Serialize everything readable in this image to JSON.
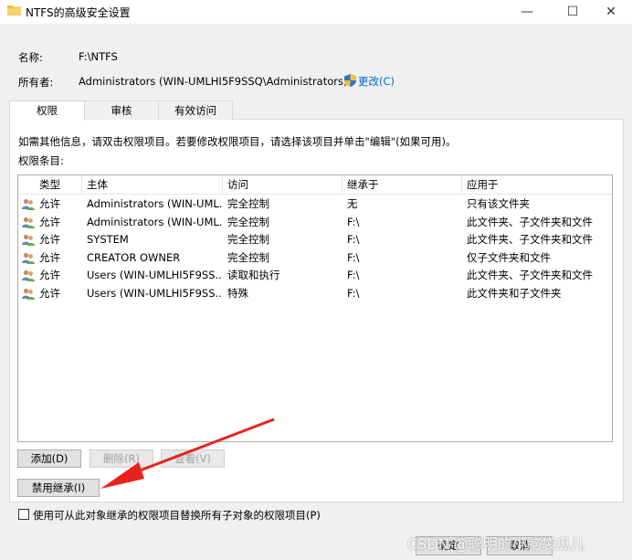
{
  "window": {
    "title": "NTFS的高级安全设置",
    "minimize": "—",
    "maximize": "☐",
    "close": "✕"
  },
  "info": {
    "name_label": "名称:",
    "name_value": "F:\\NTFS",
    "owner_label": "所有者:",
    "owner_value": "Administrators (WIN-UMLHI5F9SSQ\\Administrators)",
    "change_link": "更改(C)"
  },
  "tabs": [
    {
      "label": "权限"
    },
    {
      "label": "审核"
    },
    {
      "label": "有效访问"
    }
  ],
  "panel": {
    "description": "如需其他信息，请双击权限项目。若要修改权限项目，请选择该项目并单击\"编辑\"(如果可用)。",
    "entries_label": "权限条目:"
  },
  "table": {
    "columns": [
      "类型",
      "主体",
      "访问",
      "继承于",
      "应用于"
    ],
    "rows": [
      {
        "type": "允许",
        "principal": "Administrators (WIN-UML...",
        "access": "完全控制",
        "inherited": "无",
        "applies": "只有该文件夹"
      },
      {
        "type": "允许",
        "principal": "Administrators (WIN-UML...",
        "access": "完全控制",
        "inherited": "F:\\",
        "applies": "此文件夹、子文件夹和文件"
      },
      {
        "type": "允许",
        "principal": "SYSTEM",
        "access": "完全控制",
        "inherited": "F:\\",
        "applies": "此文件夹、子文件夹和文件"
      },
      {
        "type": "允许",
        "principal": "CREATOR OWNER",
        "access": "完全控制",
        "inherited": "F:\\",
        "applies": "仅子文件夹和文件"
      },
      {
        "type": "允许",
        "principal": "Users (WIN-UMLHI5F9SS...",
        "access": "读取和执行",
        "inherited": "F:\\",
        "applies": "此文件夹、子文件夹和文件"
      },
      {
        "type": "允许",
        "principal": "Users (WIN-UMLHI5F9SS...",
        "access": "特殊",
        "inherited": "F:\\",
        "applies": "此文件夹和子文件夹"
      }
    ]
  },
  "buttons": {
    "add": "添加(D)",
    "remove": "删除(R)",
    "view": "查看(V)",
    "disable_inheritance": "禁用继承(I)",
    "ok": "确定",
    "cancel": "取消"
  },
  "checkbox": {
    "label": "使用可从此对象继承的权限项目替换所有子对象的权限项目(P)"
  },
  "watermark": "CSDN @聪明的小脑袋瓜儿"
}
